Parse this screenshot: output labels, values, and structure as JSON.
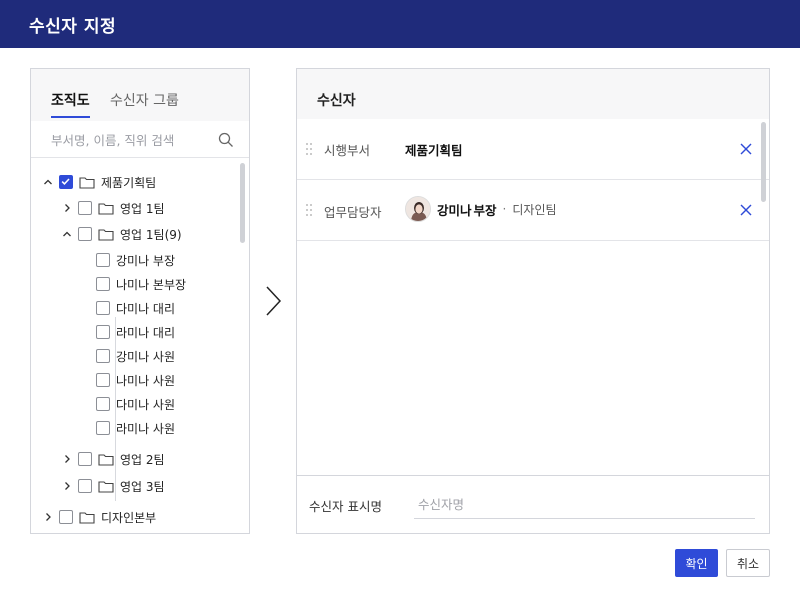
{
  "dialog": {
    "title": "수신자 지정"
  },
  "left": {
    "tabs": [
      {
        "label": "조직도"
      },
      {
        "label": "수신자 그룹"
      }
    ],
    "search": {
      "placeholder": "부서명, 이름, 직위 검색",
      "value": ""
    },
    "tree": [
      {
        "label": "제품기획팀",
        "checked": true,
        "expanded": true,
        "type": "folder"
      },
      {
        "label": "영업 1팀",
        "checked": false,
        "expanded": false,
        "type": "folder"
      },
      {
        "label": "영업 1팀(9)",
        "checked": false,
        "expanded": true,
        "type": "folder"
      },
      {
        "label": "강미나 부장",
        "checked": false,
        "type": "person"
      },
      {
        "label": "나미나 본부장",
        "checked": false,
        "type": "person"
      },
      {
        "label": "다미나 대리",
        "checked": false,
        "type": "person"
      },
      {
        "label": "라미나 대리",
        "checked": false,
        "type": "person"
      },
      {
        "label": "강미나 사원",
        "checked": false,
        "type": "person"
      },
      {
        "label": "나미나 사원",
        "checked": false,
        "type": "person"
      },
      {
        "label": "다미나 사원",
        "checked": false,
        "type": "person"
      },
      {
        "label": "라미나 사원",
        "checked": false,
        "type": "person"
      },
      {
        "label": "영업 2팀",
        "checked": false,
        "expanded": false,
        "type": "folder"
      },
      {
        "label": "영업 3팀",
        "checked": false,
        "expanded": false,
        "type": "folder"
      },
      {
        "label": "디자인본부",
        "checked": false,
        "expanded": false,
        "type": "folder"
      }
    ]
  },
  "right": {
    "title": "수신자",
    "recipients": [
      {
        "role": "시행부서",
        "name": "제품기획팀"
      },
      {
        "role": "업무담당자",
        "name": "강미나",
        "position": "부장",
        "separator": "·",
        "team": "디자인팀"
      }
    ],
    "display_name": {
      "label": "수신자 표시명",
      "placeholder": "수신자명",
      "value": ""
    }
  },
  "buttons": {
    "ok": "확인",
    "cancel": "취소"
  },
  "colors": {
    "header": "#1f2b7b",
    "accent": "#2f4bd8"
  }
}
